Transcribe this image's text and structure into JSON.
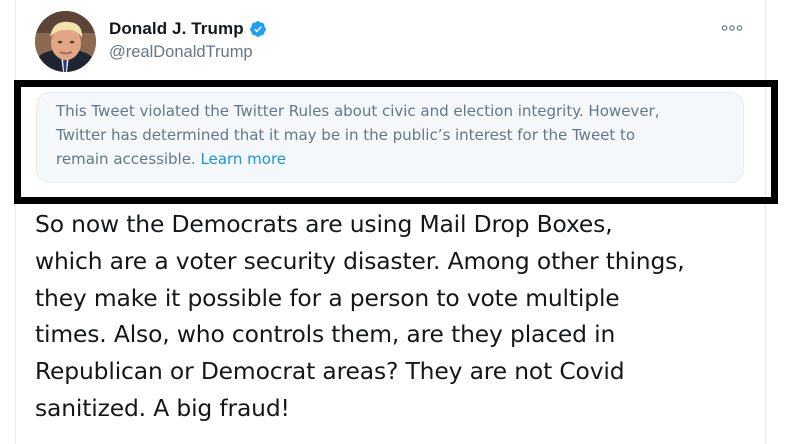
{
  "author": {
    "display_name": "Donald J. Trump",
    "handle": "@realDonaldTrump",
    "verified": true,
    "avatar_icon": "profile-photo",
    "verified_icon": "verified-badge-icon",
    "more_icon": "more-options-icon"
  },
  "notice": {
    "lines": [
      "This Tweet violated the Twitter Rules about civic and election integrity. However,",
      "Twitter has determined that it may be in the public’s interest for the Tweet to",
      "remain accessible."
    ],
    "link_label": "Learn more"
  },
  "tweet": {
    "lines": [
      "So now the Democrats are using Mail Drop Boxes,",
      "which are a voter security disaster. Among other things,",
      "they make it possible for a person to vote multiple",
      "times. Also, who controls them, are they placed in",
      "Republican or Democrat areas? They are not Covid",
      "sanitized. A big fraud!"
    ]
  },
  "colors": {
    "text": "#14171a",
    "secondary": "#657786",
    "link": "#1b95e0",
    "verified": "#1da1f2",
    "notice_bg": "#f5f8fa",
    "frame": "#000000"
  }
}
